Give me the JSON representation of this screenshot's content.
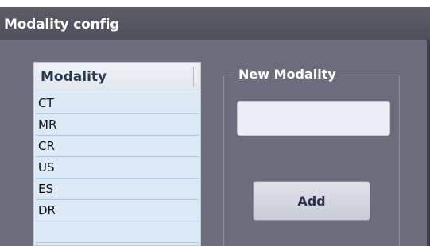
{
  "window": {
    "title": "Modality config"
  },
  "modality_list": {
    "header": "Modality",
    "items": [
      "CT",
      "MR",
      "CR",
      "US",
      "ES",
      "DR"
    ]
  },
  "new_modality": {
    "group_label": "New Modality",
    "input_value": "",
    "add_label": "Add"
  }
}
